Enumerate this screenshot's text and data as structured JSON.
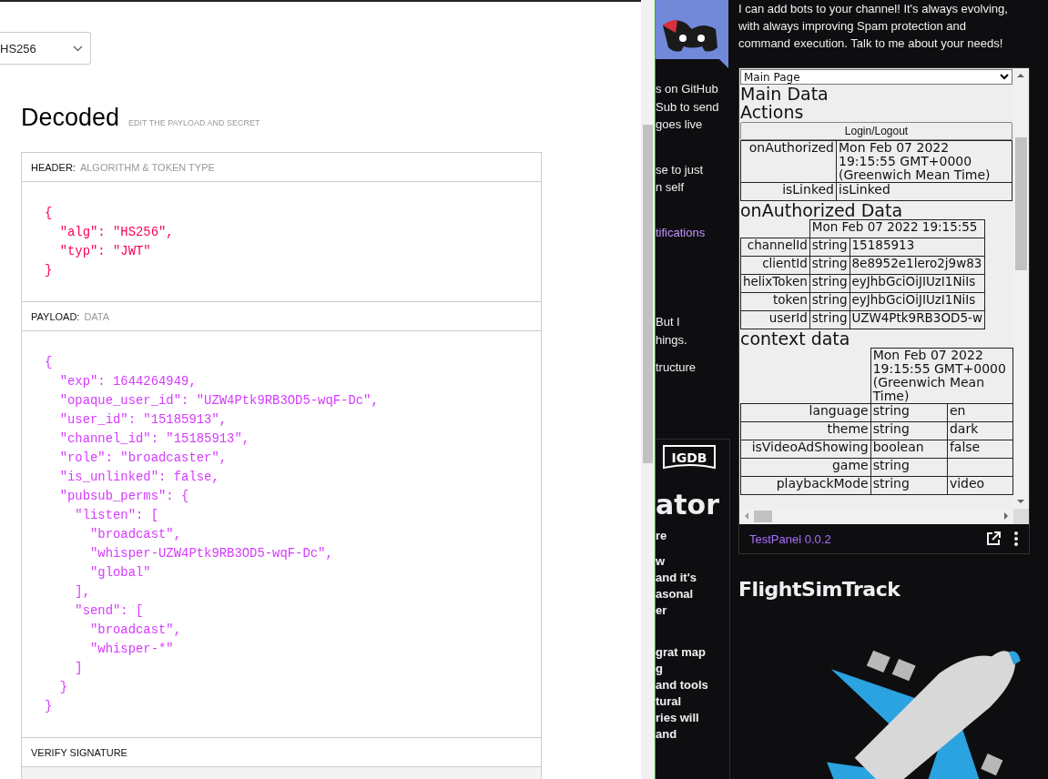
{
  "algorithm_select": {
    "value": "HS256"
  },
  "decoded": {
    "title": "Decoded",
    "subtitle": "EDIT THE PAYLOAD AND SECRET"
  },
  "sections": [
    {
      "kind": "header",
      "label": "HEADER:",
      "hint": "ALGORITHM & TOKEN TYPE",
      "lines": [
        "{",
        "  \"alg\": \"HS256\",",
        "  \"typ\": \"JWT\"",
        "}"
      ]
    },
    {
      "kind": "payload",
      "label": "PAYLOAD:",
      "hint": "DATA",
      "lines": [
        "{",
        "  \"exp\": 1644264949,",
        "  \"opaque_user_id\": \"UZW4Ptk9RB3OD5-wqF-Dc\",",
        "  \"user_id\": \"15185913\",",
        "  \"channel_id\": \"15185913\",",
        "  \"role\": \"broadcaster\",",
        "  \"is_unlinked\": false,",
        "  \"pubsub_perms\": {",
        "    \"listen\": [",
        "      \"broadcast\",",
        "      \"whisper-UZW4Ptk9RB3OD5-wqF-Dc\",",
        "      \"global\"",
        "    ],",
        "    \"send\": [",
        "      \"broadcast\",",
        "      \"whisper-*\"",
        "    ]",
        "  }",
        "}"
      ]
    },
    {
      "kind": "signature",
      "label": "VERIFY SIGNATURE"
    }
  ],
  "side_column": {
    "paragraphs": [
      {
        "kind": "text",
        "lines": [
          "s on GitHub",
          "Sub to send",
          "goes live"
        ]
      },
      {
        "kind": "text",
        "lines": [
          "se to just",
          "n self"
        ]
      },
      {
        "kind": "link",
        "lines": [
          "tifications"
        ]
      },
      {
        "kind": "text",
        "lines": [
          "But I",
          "hings."
        ]
      },
      {
        "kind": "text",
        "lines": [
          "tructure"
        ]
      }
    ],
    "card": {
      "logo": "IGDB",
      "title": "ator",
      "paragraphs": [
        [
          "re"
        ],
        [
          "w",
          "and it's",
          "asonal",
          "er"
        ],
        [
          "grat map",
          "g",
          "and tools",
          "tural",
          "ries will",
          "and"
        ]
      ]
    }
  },
  "about": {
    "text": "I can add bots to your channel! It's always evolving, with always improving Spam protection and command execution. Talk to me about your needs!"
  },
  "extension_panel": {
    "page_select": "Main Page",
    "heading": "Main Data",
    "subheading": "Actions",
    "button": "Login/Logout",
    "auth_rows": [
      {
        "name": "onAuthorized",
        "value": "Mon Feb 07 2022 19:15:55 GMT+0000 (Greenwich Mean Time)"
      },
      {
        "name": "isLinked",
        "value": "isLinked"
      }
    ],
    "auth_data_title": "onAuthorized Data",
    "auth_data_time": "Mon Feb 07 2022 19:15:55",
    "auth_data_rows": [
      {
        "name": "channelId",
        "type": "string",
        "value": "15185913"
      },
      {
        "name": "clientId",
        "type": "string",
        "value": "8e8952e1lero2j9w83"
      },
      {
        "name": "helixToken",
        "type": "string",
        "value": "eyJhbGciOiJIUzI1NiIs"
      },
      {
        "name": "token",
        "type": "string",
        "value": "eyJhbGciOiJIUzI1NiIs"
      },
      {
        "name": "userId",
        "type": "string",
        "value": "UZW4Ptk9RB3OD5-w"
      }
    ],
    "context_title": "context data",
    "context_time": "Mon Feb 07 2022 19:15:55 GMT+0000 (Greenwich Mean Time)",
    "context_rows": [
      {
        "name": "language",
        "type": "string",
        "value": "en"
      },
      {
        "name": "theme",
        "type": "string",
        "value": "dark"
      },
      {
        "name": "isVideoAdShowing",
        "type": "boolean",
        "value": "false"
      },
      {
        "name": "game",
        "type": "string"
      },
      {
        "name": "playbackMode",
        "type": "string",
        "value": "video"
      }
    ],
    "footer": "TestPanel 0.0.2"
  },
  "featured": {
    "title": "FlightSimTrack"
  }
}
